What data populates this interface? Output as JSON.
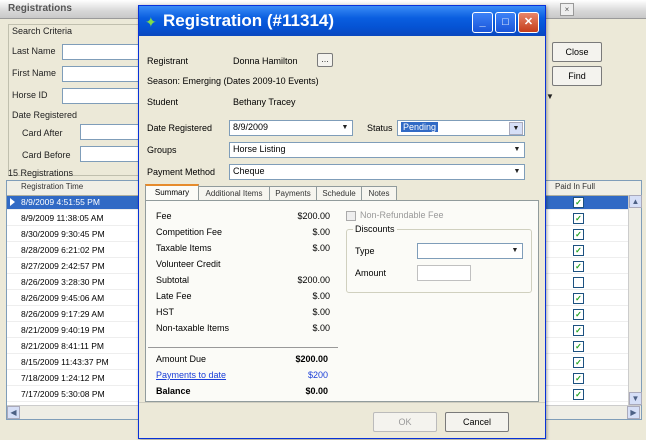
{
  "background_window": {
    "title": "Registrations",
    "close_glyph": "×",
    "search_group_title": "Search Criteria",
    "fields": [
      {
        "label": "Last Name"
      },
      {
        "label": "First Name"
      },
      {
        "label": "Horse ID"
      },
      {
        "label": "Date Registered"
      },
      {
        "label": "Card After"
      },
      {
        "label": "Card Before"
      }
    ],
    "buttons": {
      "close": "Close",
      "find": "Find"
    },
    "grid_caption": "15 Registrations",
    "grid_columns": {
      "registration_time": "Registration Time",
      "paid_in_full": "Paid In Full"
    },
    "rows": [
      {
        "time": "8/9/2009 4:51:55 PM",
        "selected": true,
        "paid": true
      },
      {
        "time": "8/9/2009 11:38:05 AM",
        "paid": true
      },
      {
        "time": "8/30/2009 9:30:45 PM",
        "paid": true
      },
      {
        "time": "8/28/2009 6:21:02 PM",
        "paid": true
      },
      {
        "time": "8/27/2009 2:42:57 PM",
        "paid": true
      },
      {
        "time": "8/26/2009 3:28:30 PM",
        "paid": false
      },
      {
        "time": "8/26/2009 9:45:06 AM",
        "paid": true
      },
      {
        "time": "8/26/2009 9:17:29 AM",
        "paid": true
      },
      {
        "time": "8/21/2009 9:40:19 PM",
        "paid": true
      },
      {
        "time": "8/21/2009 8:41:11 PM",
        "paid": true
      },
      {
        "time": "8/15/2009 11:43:37 PM",
        "paid": true
      },
      {
        "time": "7/18/2009 1:24:12 PM",
        "paid": true
      },
      {
        "time": "7/17/2009 5:30:08 PM",
        "paid": true
      }
    ]
  },
  "dialog": {
    "title": "Registration (#11314)",
    "controls": {
      "minimize": "_",
      "maximize": "□",
      "close": "✕"
    },
    "lbl_registrant": "Registrant",
    "registrant_value": "Donna Hamilton",
    "season": "Season: Emerging (Dates 2009-10 Events)",
    "lbl_student": "Student",
    "student_value": "Bethany Tracey",
    "lbl_date_registered": "Date Registered",
    "date_registered": "8/9/2009",
    "lbl_status": "Status",
    "status_value": "Pending",
    "lbl_groups": "Groups",
    "groups_value": "Horse Listing",
    "lbl_payment": "Payment Method",
    "payment_value": "Cheque",
    "tabs": [
      "Summary",
      "Additional Items",
      "Payments",
      "Schedule",
      "Notes"
    ],
    "fees": [
      {
        "label": "Fee",
        "value": "$200.00"
      },
      {
        "label": "Competition Fee",
        "value": "$.00"
      },
      {
        "label": "Taxable Items",
        "value": "$.00"
      },
      {
        "label": "Volunteer Credit",
        "value": ""
      },
      {
        "label": "Subtotal",
        "value": "$200.00"
      },
      {
        "label": "Late Fee",
        "value": "$.00"
      },
      {
        "label": "HST",
        "value": "$.00"
      },
      {
        "label": "Non-taxable Items",
        "value": "$.00"
      }
    ],
    "amount_due_label": "Amount Due",
    "amount_due": "$200.00",
    "payments_label": "Payments to date",
    "payments_value": "$200",
    "balance_label": "Balance",
    "balance": "$0.00",
    "non_refundable": "Non-Refundable Fee",
    "discount_group_title": "Discounts",
    "discount_type_label": "Type",
    "discount_amount_label": "Amount",
    "ok_label": "OK",
    "cancel_label": "Cancel"
  },
  "colors": {
    "selection": "#316ac5",
    "title_blue": "#0a5ee0",
    "link_blue": "#1a3ed8"
  }
}
